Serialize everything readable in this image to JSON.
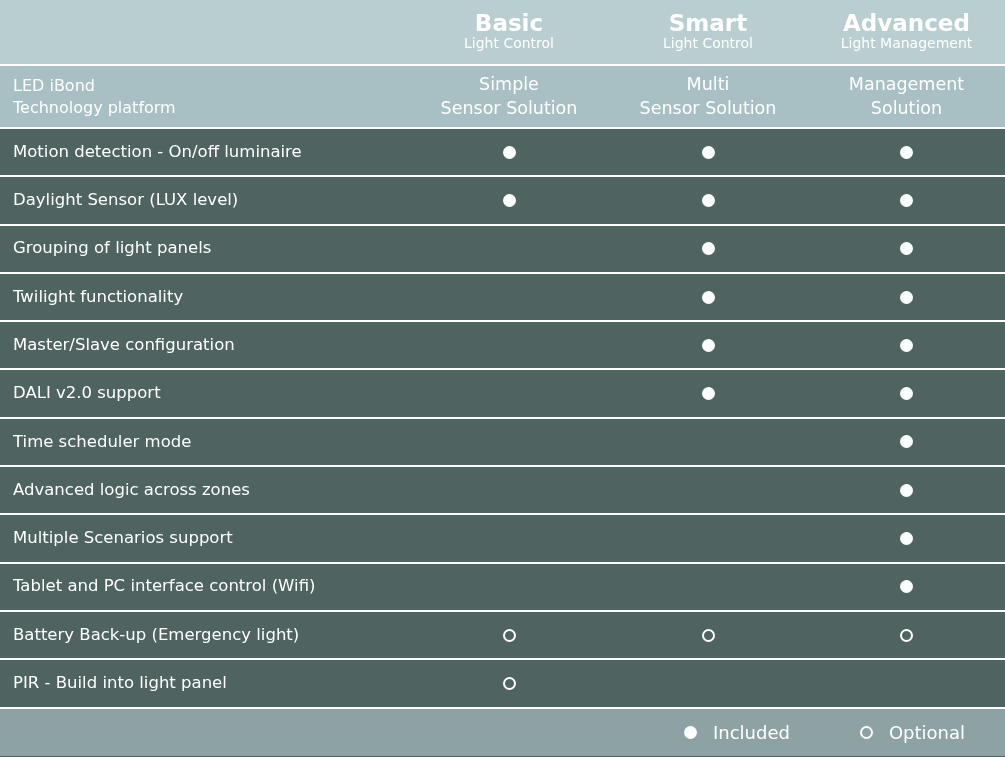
{
  "plans": [
    {
      "name": "Basic",
      "subtitle": "Light Control"
    },
    {
      "name": "Smart",
      "subtitle": "Light Control"
    },
    {
      "name": "Advanced",
      "subtitle": "Light Management"
    }
  ],
  "platform": {
    "label": [
      "LED iBond",
      "Technology platform"
    ],
    "solutions": [
      [
        "Simple",
        "Sensor Solution"
      ],
      [
        "Multi",
        "Sensor Solution"
      ],
      [
        "Management",
        "Solution"
      ]
    ]
  },
  "features": [
    {
      "label": "Motion detection - On/off luminaire",
      "cells": [
        {
          "kind": "included"
        },
        {
          "kind": "included"
        },
        {
          "kind": "included"
        }
      ]
    },
    {
      "label": "Daylight Sensor (LUX level)",
      "cells": [
        {
          "kind": "included"
        },
        {
          "kind": "included"
        },
        {
          "kind": "included"
        }
      ]
    },
    {
      "label": "Grouping of light panels",
      "cells": [
        {
          "kind": "blank"
        },
        {
          "kind": "included"
        },
        {
          "kind": "included"
        }
      ]
    },
    {
      "label": "Twilight functionality",
      "cells": [
        {
          "kind": "blank"
        },
        {
          "kind": "included"
        },
        {
          "kind": "included"
        }
      ]
    },
    {
      "label": "Master/Slave configuration",
      "cells": [
        {
          "kind": "blank"
        },
        {
          "kind": "included"
        },
        {
          "kind": "included"
        }
      ]
    },
    {
      "label": "DALI v2.0 support",
      "cells": [
        {
          "kind": "blank"
        },
        {
          "kind": "included"
        },
        {
          "kind": "included"
        }
      ]
    },
    {
      "label": "Time scheduler mode",
      "cells": [
        {
          "kind": "blank"
        },
        {
          "kind": "blank"
        },
        {
          "kind": "included"
        }
      ]
    },
    {
      "label": "Advanced logic across zones",
      "cells": [
        {
          "kind": "blank"
        },
        {
          "kind": "blank"
        },
        {
          "kind": "included"
        }
      ]
    },
    {
      "label": "Multiple Scenarios support",
      "cells": [
        {
          "kind": "blank"
        },
        {
          "kind": "blank"
        },
        {
          "kind": "included"
        }
      ]
    },
    {
      "label": "Tablet and PC interface control (Wifi)",
      "cells": [
        {
          "kind": "blank"
        },
        {
          "kind": "blank"
        },
        {
          "kind": "included"
        }
      ]
    },
    {
      "label": "Battery Back-up (Emergency light)",
      "cells": [
        {
          "kind": "optional"
        },
        {
          "kind": "optional"
        },
        {
          "kind": "optional"
        }
      ]
    },
    {
      "label": "PIR - Build into light panel",
      "cells": [
        {
          "kind": "optional"
        },
        {
          "kind": "blank"
        },
        {
          "kind": "blank"
        }
      ]
    }
  ],
  "legend": [
    {
      "kind": "included",
      "label": "Included"
    },
    {
      "kind": "optional",
      "label": "Optional"
    }
  ]
}
